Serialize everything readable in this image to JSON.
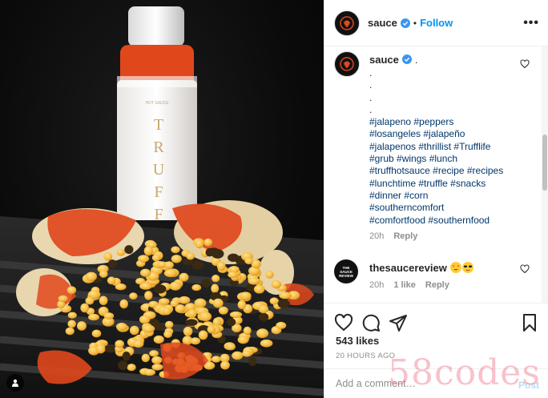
{
  "post": {
    "author": "sauce",
    "follow_label": "Follow",
    "dot_separator": "•",
    "more_label": "•••"
  },
  "photo": {
    "bottle_label": "TRUFF",
    "bottle_small_text": "HOT SAUCE"
  },
  "caption": {
    "author": "sauce",
    "trail": ".",
    "lines": [
      ".",
      ".",
      ".",
      "."
    ],
    "hashtag_lines": [
      "#jalapeno #peppers",
      "#losangeles #jalapeño",
      "#jalapenos #thrillist #Trufflife",
      "#grub #wings #lunch",
      "#truffhotsauce #recipe #recipes",
      "#lunchtime #truffle #snacks",
      "#dinner #corn",
      "#southerncomfort",
      "#comfortfood #southernfood"
    ],
    "time": "20h",
    "reply_label": "Reply"
  },
  "comment": {
    "author": "thesaucereview",
    "avatar_text": "THE SAUCE REVIEW",
    "time": "20h",
    "likes": "1 like",
    "reply_label": "Reply"
  },
  "stats": {
    "likes": "543 likes",
    "timestamp": "20 HOURS AGO"
  },
  "add_comment": {
    "placeholder": "Add a comment…",
    "post_label": "Post"
  },
  "watermark": "58codes",
  "colors": {
    "link": "#0095f6",
    "hashtag": "#00376b",
    "muted": "#8e8e8e",
    "sauce": "#e0481c",
    "corn": "#f2b63a"
  }
}
